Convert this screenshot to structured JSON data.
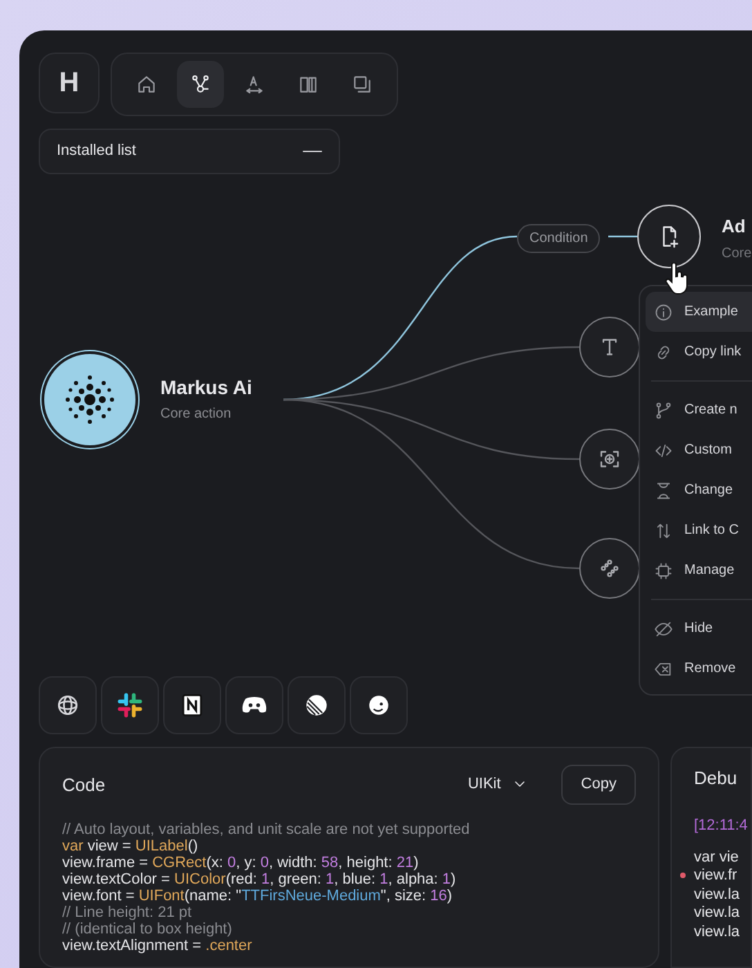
{
  "logo": "H",
  "toolbar": [
    {
      "selected": false
    },
    {
      "selected": true
    },
    {
      "selected": false
    },
    {
      "selected": false
    },
    {
      "selected": false
    }
  ],
  "installed_list": {
    "label": "Installed list"
  },
  "canvas": {
    "source_node": {
      "title": "Markus Ai",
      "subtitle": "Core action"
    },
    "condition": "Condition",
    "target_node": {
      "title": "Ad",
      "subtitle": "Core"
    },
    "context_menu": [
      [
        {
          "label": "Example",
          "selected": true
        },
        {
          "label": "Copy link",
          "selected": false
        }
      ],
      [
        {
          "label": "Create n",
          "selected": false
        },
        {
          "label": "Custom",
          "selected": false
        },
        {
          "label": "Change",
          "selected": false
        },
        {
          "label": "Link to C",
          "selected": false
        },
        {
          "label": "Manage",
          "selected": false
        }
      ],
      [
        {
          "label": "Hide",
          "selected": false
        },
        {
          "label": "Remove",
          "selected": false
        }
      ]
    ]
  },
  "code_panel": {
    "title": "Code",
    "framework": "UIKit",
    "copy_button": "Copy",
    "lines": [
      [
        {
          "kind": "comment",
          "text": "// Auto layout, variables, and unit scale are not yet supported"
        }
      ],
      [
        {
          "kind": "keyword",
          "text": "var"
        },
        {
          "kind": "plain",
          "text": " view = "
        },
        {
          "kind": "type",
          "text": "UILabel"
        },
        {
          "kind": "plain",
          "text": "()"
        }
      ],
      [
        {
          "kind": "plain",
          "text": "view.frame = "
        },
        {
          "kind": "type",
          "text": "CGRect"
        },
        {
          "kind": "plain",
          "text": "(x: "
        },
        {
          "kind": "number",
          "text": "0"
        },
        {
          "kind": "plain",
          "text": ", y: "
        },
        {
          "kind": "number",
          "text": "0"
        },
        {
          "kind": "plain",
          "text": ", width: "
        },
        {
          "kind": "number",
          "text": "58"
        },
        {
          "kind": "plain",
          "text": ", height: "
        },
        {
          "kind": "number",
          "text": "21"
        },
        {
          "kind": "plain",
          "text": ")"
        }
      ],
      [
        {
          "kind": "plain",
          "text": "view.textColor = "
        },
        {
          "kind": "type",
          "text": "UIColor"
        },
        {
          "kind": "plain",
          "text": "(red: "
        },
        {
          "kind": "number",
          "text": "1"
        },
        {
          "kind": "plain",
          "text": ", green: "
        },
        {
          "kind": "number",
          "text": "1"
        },
        {
          "kind": "plain",
          "text": ", blue: "
        },
        {
          "kind": "number",
          "text": "1"
        },
        {
          "kind": "plain",
          "text": ", alpha: "
        },
        {
          "kind": "number",
          "text": "1"
        },
        {
          "kind": "plain",
          "text": ")"
        }
      ],
      [
        {
          "kind": "plain",
          "text": "view.font = "
        },
        {
          "kind": "type",
          "text": "UIFont"
        },
        {
          "kind": "plain",
          "text": "(name: \""
        },
        {
          "kind": "string",
          "text": "TTFirsNeue-Medium"
        },
        {
          "kind": "plain",
          "text": "\", size: "
        },
        {
          "kind": "number",
          "text": "16"
        },
        {
          "kind": "plain",
          "text": ")"
        }
      ],
      [
        {
          "kind": "comment",
          "text": "// Line height: 21 pt"
        }
      ],
      [
        {
          "kind": "comment",
          "text": "// (identical to box height)"
        }
      ],
      [
        {
          "kind": "plain",
          "text": "view.textAlignment = "
        },
        {
          "kind": "type",
          "text": ".center"
        }
      ]
    ]
  },
  "debug_panel": {
    "title": "Debu",
    "timestamp": "[12:11:4",
    "lines": [
      {
        "text": "var vie",
        "flagged": false
      },
      {
        "text": "view.fr",
        "flagged": true
      },
      {
        "text": "view.la",
        "flagged": false
      },
      {
        "text": "view.la",
        "flagged": false
      },
      {
        "text": "view.la",
        "flagged": false
      }
    ]
  }
}
